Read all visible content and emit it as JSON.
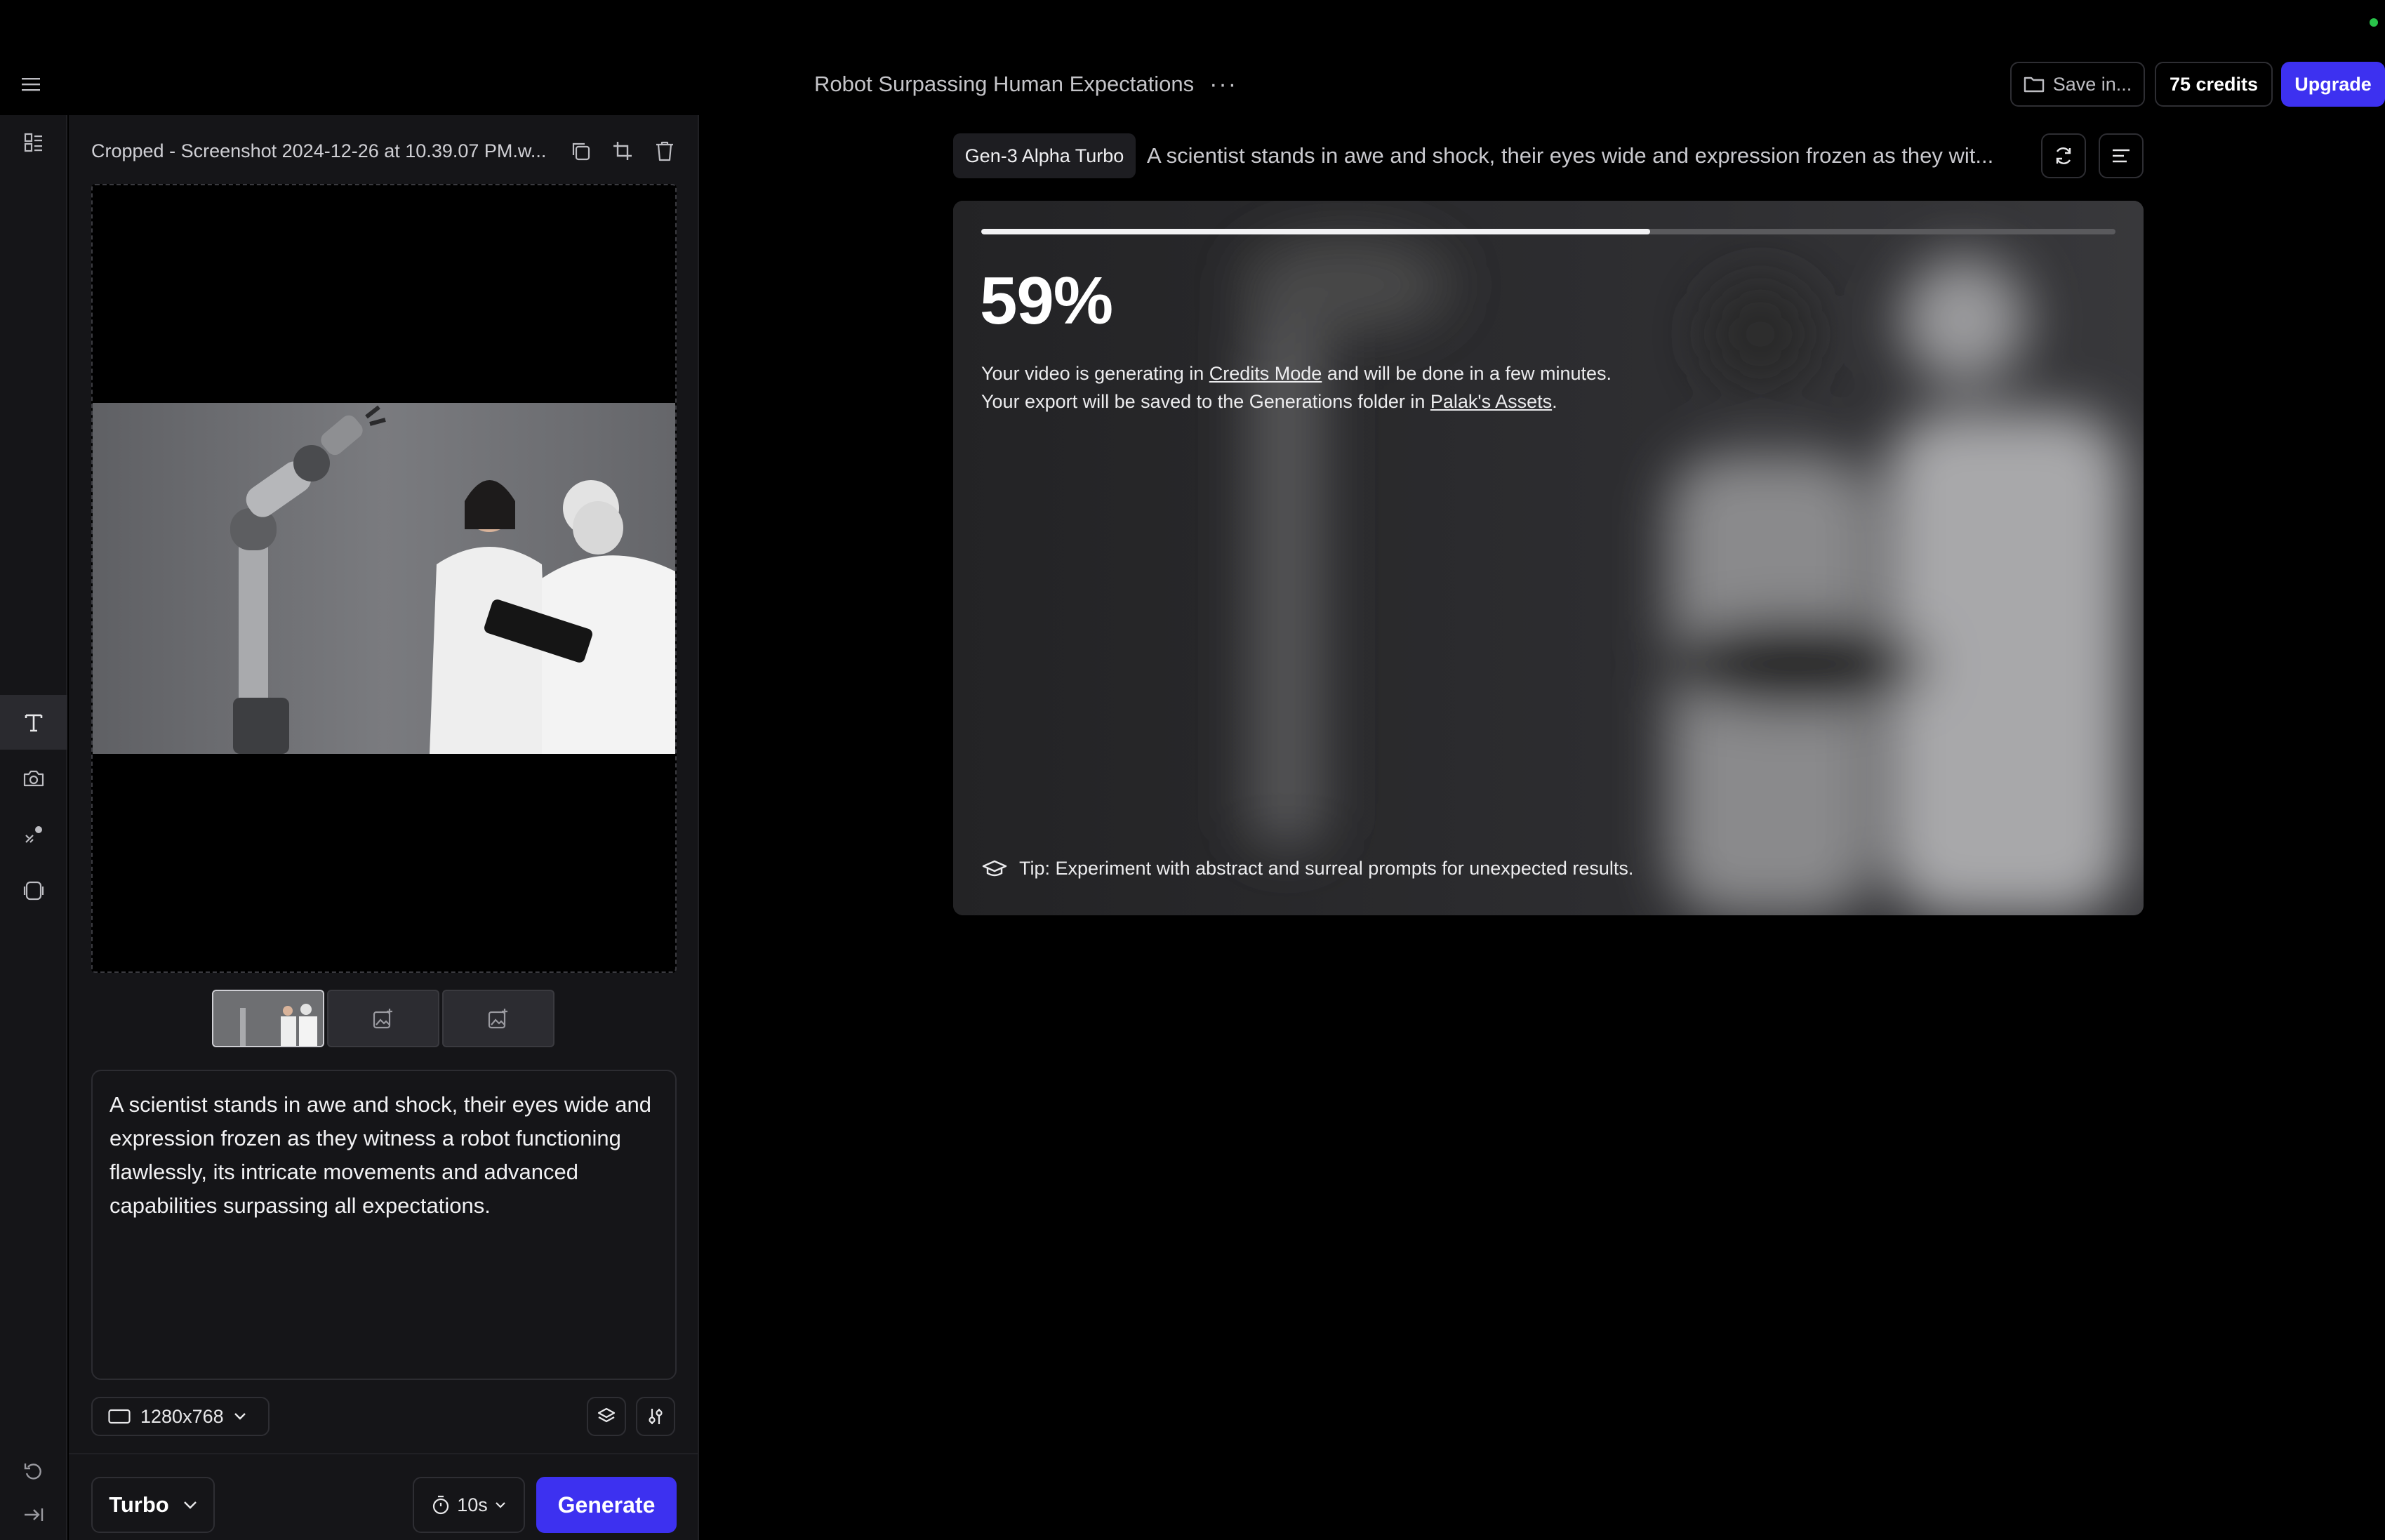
{
  "header": {
    "title": "Robot Surpassing Human Expectations",
    "more_label": "···",
    "save_label": "Save in...",
    "credits_label": "75 credits",
    "upgrade_label": "Upgrade"
  },
  "rail": {
    "items": [
      "assets-icon",
      "text-icon",
      "camera-icon",
      "motion-brush-icon",
      "layers-icon"
    ],
    "active": "text-icon"
  },
  "panel": {
    "file_name": "Cropped - Screenshot 2024-12-26 at 10.39.07 PM.w...",
    "prompt_text": "A scientist stands in awe and shock, their eyes wide and expression frozen as they witness a robot functioning flawlessly, its intricate movements and advanced capabilities surpassing all expectations.",
    "resolution_label": "1280x768",
    "mode_label": "Turbo",
    "duration_label": "10s",
    "generate_label": "Generate"
  },
  "main": {
    "model_label": "Gen-3 Alpha Turbo",
    "prompt_preview": "A scientist stands in awe and shock, their eyes wide and expression frozen as they wit...",
    "progress": 0.59,
    "progress_label": "59%",
    "message": {
      "line1_pre": "Your video is generating in ",
      "line1_link": "Credits Mode",
      "line1_post": " and will be done in a few minutes.",
      "line2_pre": "Your export will be saved to the Generations folder in ",
      "line2_link": "Palak's Assets",
      "line2_post": "."
    },
    "tip": "Tip: Experiment with abstract and surreal prompts for unexpected results."
  },
  "colors": {
    "accent": "#3d31f0",
    "background": "#000000",
    "panel": "#151518",
    "status_dot": "#29c44a"
  }
}
